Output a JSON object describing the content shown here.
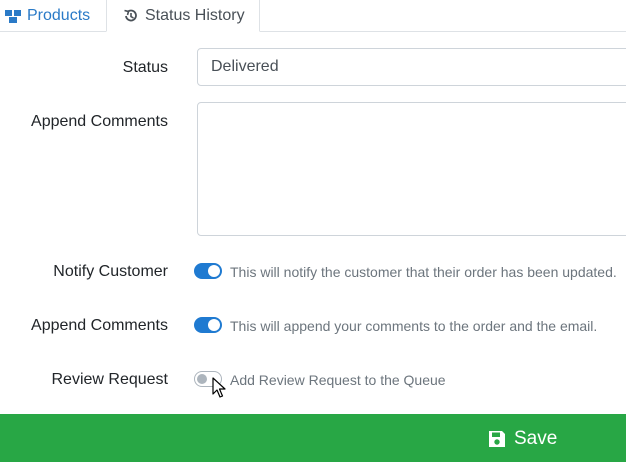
{
  "tabs": {
    "products": {
      "label": "Products",
      "icon": "boxes-icon",
      "active": false
    },
    "status_history": {
      "label": "Status History",
      "icon": "history-icon",
      "active": true
    }
  },
  "form": {
    "status": {
      "label": "Status",
      "value": "Delivered"
    },
    "append_comments_text": {
      "label": "Append Comments",
      "value": ""
    },
    "notify_customer": {
      "label": "Notify Customer",
      "checked": true,
      "hint": "This will notify the customer that their order has been updated."
    },
    "append_comments_toggle": {
      "label": "Append Comments",
      "checked": true,
      "hint": "This will append your comments to the order and the email."
    },
    "review_request": {
      "label": "Review Request",
      "checked": false,
      "hint": "Add Review Request to the Queue"
    }
  },
  "save_button": {
    "label": "Save",
    "icon": "save-icon",
    "color": "#28a745"
  },
  "colors": {
    "accent": "#1f7ad1",
    "link": "#2a7ac7",
    "success": "#28a745"
  }
}
